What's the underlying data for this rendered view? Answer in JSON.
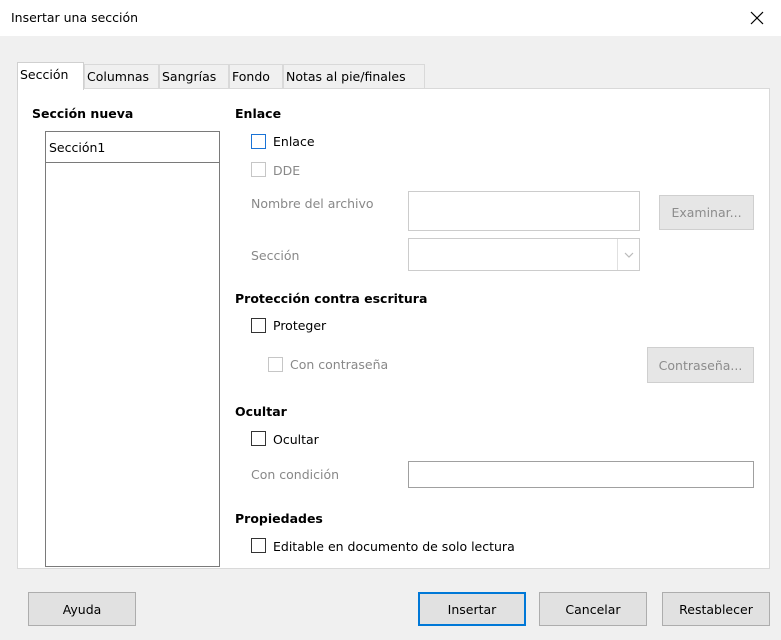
{
  "window": {
    "title": "Insertar una sección"
  },
  "tabs": [
    {
      "label": "Sección"
    },
    {
      "label": "Columnas"
    },
    {
      "label": "Sangrías"
    },
    {
      "label": "Fondo"
    },
    {
      "label": "Notas al pie/finales"
    }
  ],
  "new_section": {
    "heading": "Sección nueva",
    "name_value": "Sección1"
  },
  "link": {
    "heading": "Enlace",
    "link_checkbox": "Enlace",
    "dde_checkbox": "DDE",
    "filename_label": "Nombre del archivo",
    "filename_value": "",
    "browse_button": "Examinar...",
    "section_label": "Sección",
    "section_value": ""
  },
  "protection": {
    "heading": "Protección contra escritura",
    "protect_checkbox": "Proteger",
    "password_checkbox": "Con contraseña",
    "password_button": "Contraseña..."
  },
  "hide": {
    "heading": "Ocultar",
    "hide_checkbox": "Ocultar",
    "condition_label": "Con condición",
    "condition_value": ""
  },
  "properties": {
    "heading": "Propiedades",
    "editable_checkbox": "Editable en documento de solo lectura"
  },
  "buttons": {
    "help": "Ayuda",
    "insert": "Insertar",
    "cancel": "Cancelar",
    "reset": "Restablecer"
  },
  "colors": {
    "accent": "#0078d7",
    "checkbox_focus": "#1a73d6"
  }
}
